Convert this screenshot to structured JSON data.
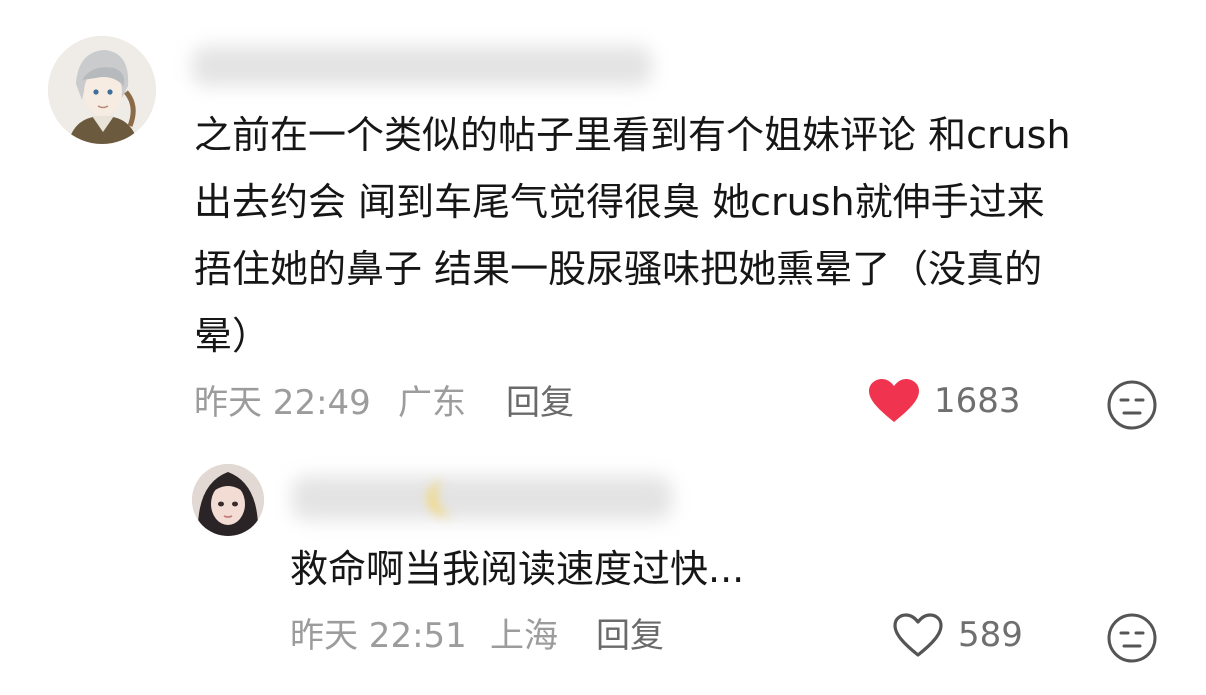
{
  "comments": [
    {
      "username": "",
      "text_lines": [
        "之前在一个类似的帖子里看到有个姐妹评论 和crush",
        "出去约会 闻到车尾气觉得很臭 她crush就伸手过来",
        "捂住她的鼻子 结果一股尿骚味把她熏晕了（没真的",
        "晕）"
      ],
      "time": "昨天 22:49",
      "location": "广东",
      "reply_label": "回复",
      "likes": "1683",
      "liked": true,
      "colors": {
        "heart": "#f0344f"
      }
    },
    {
      "username": "",
      "text_lines": [
        "救命啊当我阅读速度过快..."
      ],
      "time": "昨天 22:51",
      "location": "上海",
      "reply_label": "回复",
      "likes": "589",
      "liked": false
    }
  ]
}
